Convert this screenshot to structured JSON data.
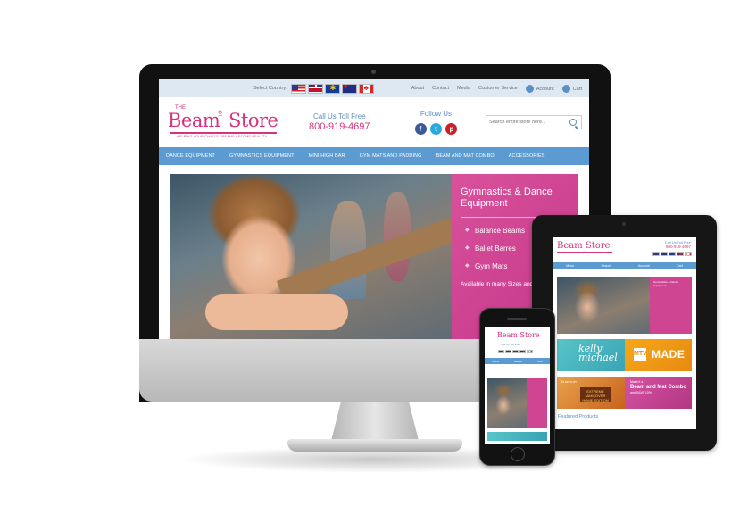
{
  "desktop": {
    "topbar": {
      "select_country": "Select Country:",
      "links": [
        "About",
        "Contact",
        "Media",
        "Customer Service"
      ],
      "account": "Account",
      "cart": "Cart"
    },
    "logo": {
      "the": "THE",
      "word1": "Beam",
      "word2": "Store",
      "tagline": "HELPING YOUR CHILD'S DREAMS BECOME REALITY"
    },
    "tollfree": {
      "label": "Call Us Toll Free",
      "phone": "800-919-4697"
    },
    "follow": {
      "label": "Follow Us",
      "facebook": "f",
      "twitter": "t",
      "pinterest": "p"
    },
    "search": {
      "placeholder": "Search entire store here..."
    },
    "nav": [
      "DANCE EQUIPMENT",
      "GYMNASTICS EQUIPMENT",
      "MINI HIGH BAR",
      "GYM MATS AND PADDING",
      "BEAM AND MAT COMBO",
      "ACCESSORIES"
    ],
    "hero": {
      "title": "Gymnastics & Dance Equipment",
      "items": [
        "Balance Beams",
        "Ballet Barres",
        "Gym Mats"
      ],
      "avail": "Available in many Sizes and Colors"
    }
  },
  "tablet": {
    "logo": "Beam Store",
    "toll_label": "Call Us Toll Free",
    "toll_phone": "800-919-4697",
    "nav": [
      "Menu",
      "Search",
      "Account",
      "Cart"
    ],
    "hero_side": "Gymnastics & Dance Equipment",
    "banner1": {
      "kelly": "kelly michael",
      "mtv": "MTV",
      "made": "MADE"
    },
    "banner2": {
      "as_seen": "As seen on",
      "extreme": "EXTREME MAKEOVER HOME EDITION",
      "make_it": "Make it a",
      "combo": "Beam and Mat Combo",
      "save": "and SAVE 10%"
    },
    "featured": "Featured Products"
  },
  "phone": {
    "logo": "Beam Store",
    "toll": "Call Us Toll Free",
    "nav": [
      "Menu",
      "Search",
      "Cart"
    ]
  },
  "colors": {
    "pink": "#d6327e",
    "blue": "#5b9bd1",
    "hero_pink": "#cf4592"
  }
}
